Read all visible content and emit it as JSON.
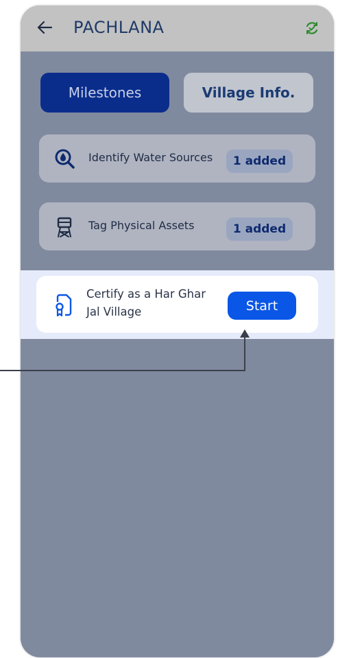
{
  "header": {
    "title": "PACHLANA",
    "back_icon": "arrow-left-icon",
    "sync_icon": "sync-check-icon",
    "sync_color": "#2e8b2e"
  },
  "tabs": [
    {
      "label": "Milestones",
      "active": true
    },
    {
      "label": "Village Info.",
      "active": false
    }
  ],
  "milestones": [
    {
      "label": "Identify Water Sources",
      "badge": "1 added",
      "icon": "water-search-icon"
    },
    {
      "label": "Tag Physical Assets",
      "badge": "1 added",
      "icon": "water-tower-icon"
    }
  ],
  "certify": {
    "label_line1": "Certify as a Har Ghar",
    "label_line2": "Jal Village",
    "icon": "certificate-icon",
    "button_label": "Start"
  },
  "colors": {
    "primary": "#0a56e6",
    "active_tab": "#0a2d8c",
    "overlay": "#808a9f"
  }
}
